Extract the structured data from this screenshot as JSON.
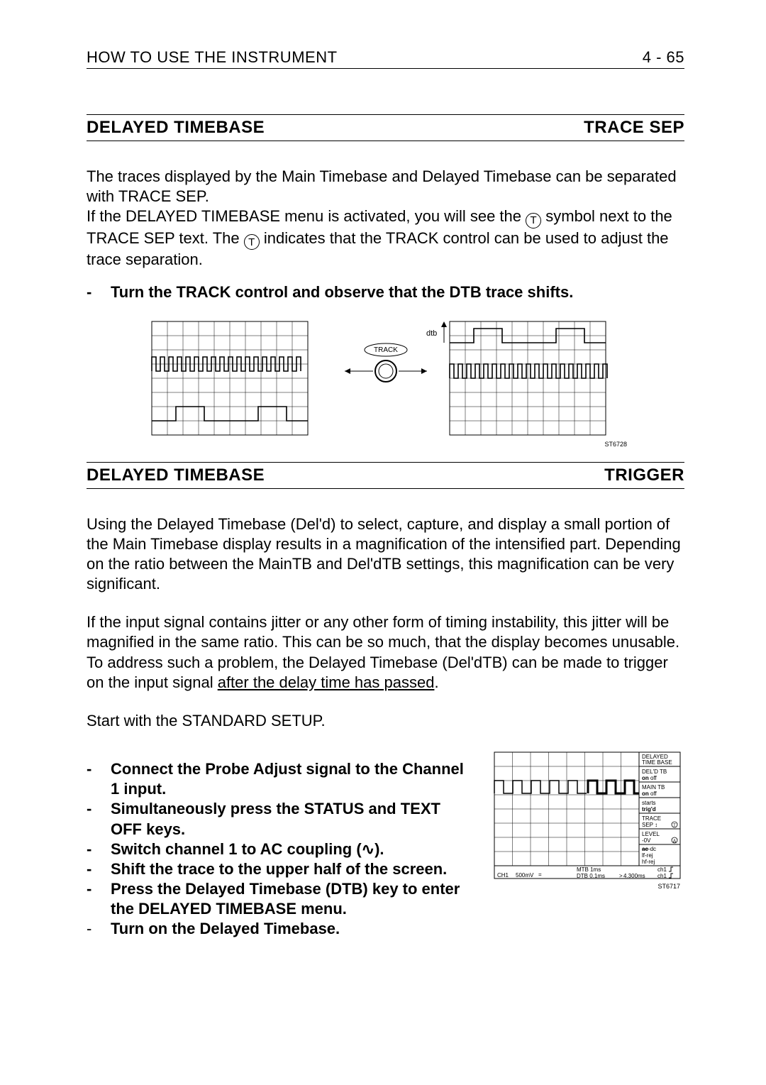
{
  "header": {
    "left": "HOW TO USE THE INSTRUMENT",
    "right": "4 - 65"
  },
  "section1": {
    "left": "DELAYED TIMEBASE",
    "right": "TRACE SEP",
    "para1a": "The traces displayed by the Main Timebase and Delayed Timebase can be separated with TRACE SEP.",
    "para1b_pre": "If the DELAYED TIMEBASE menu is activated, you will see the ",
    "tsym": "T",
    "para1b_mid": " symbol next to the TRACE SEP text. The ",
    "para1b_post": " indicates that the TRACK control can be used to adjust the trace separation.",
    "bullet1": "Turn the TRACK control and observe that the DTB trace shifts.",
    "fig": {
      "dtb": "dtb",
      "track": "TRACK",
      "id": "ST6728"
    }
  },
  "section2": {
    "left": "DELAYED TIMEBASE",
    "right": "TRIGGER",
    "para1": "Using the Delayed Timebase (Del'd) to select, capture, and display a small portion of the Main Timebase display results in a magnification of the intensified part. Depending on the ratio between the MainTB and Del'dTB settings, this magnification can be very significant.",
    "para2_pre": "If the input signal contains jitter or any other form of timing instability, this jitter will be magnified in the same ratio. This can be so much, that the display becomes unusable. To address such a problem, the Delayed Timebase (Del'dTB) can be made to trigger on the input signal ",
    "para2_under": "after the delay time has passed",
    "para2_post": ".",
    "para3": "Start with the STANDARD SETUP.",
    "bullets": [
      "Connect the Probe Adjust signal to the Channel 1 input.",
      "Simultaneously press the STATUS and TEXT OFF keys.",
      "Switch channel 1 to AC coupling (",
      "Shift the trace to the upper half of the screen.",
      "Press the Delayed Timebase (DTB) key to enter the DELAYED TIMEBASE menu.",
      "Turn on the Delayed Timebase."
    ],
    "bullet_ac_suffix": ").",
    "fig": {
      "title1": "DELAYED",
      "title2": "TIME BASE",
      "m1a": "DEL'D TB",
      "m1b_on": "on",
      "m1b_off": " off",
      "m2a": "MAIN TB",
      "m2b_on": "on",
      "m2b_off": " off",
      "m3a": "starts",
      "m3b": "trig'd",
      "m4a": "TRACE",
      "m4b": "SEP",
      "m5a": "LEVEL",
      "m5b": "-0V",
      "m6a": "ac",
      "m6b": "-dc",
      "m6c": "lf-rej",
      "m6d": "hf-rej",
      "bl_ch": "CH1",
      "bl_v": "500mV",
      "bl_mtb": "MTB  1ms",
      "bl_dtb": "DTB  0.1ms",
      "bl_dly": "4.300ms",
      "bl_src": "ch1",
      "id": "ST6717"
    }
  }
}
